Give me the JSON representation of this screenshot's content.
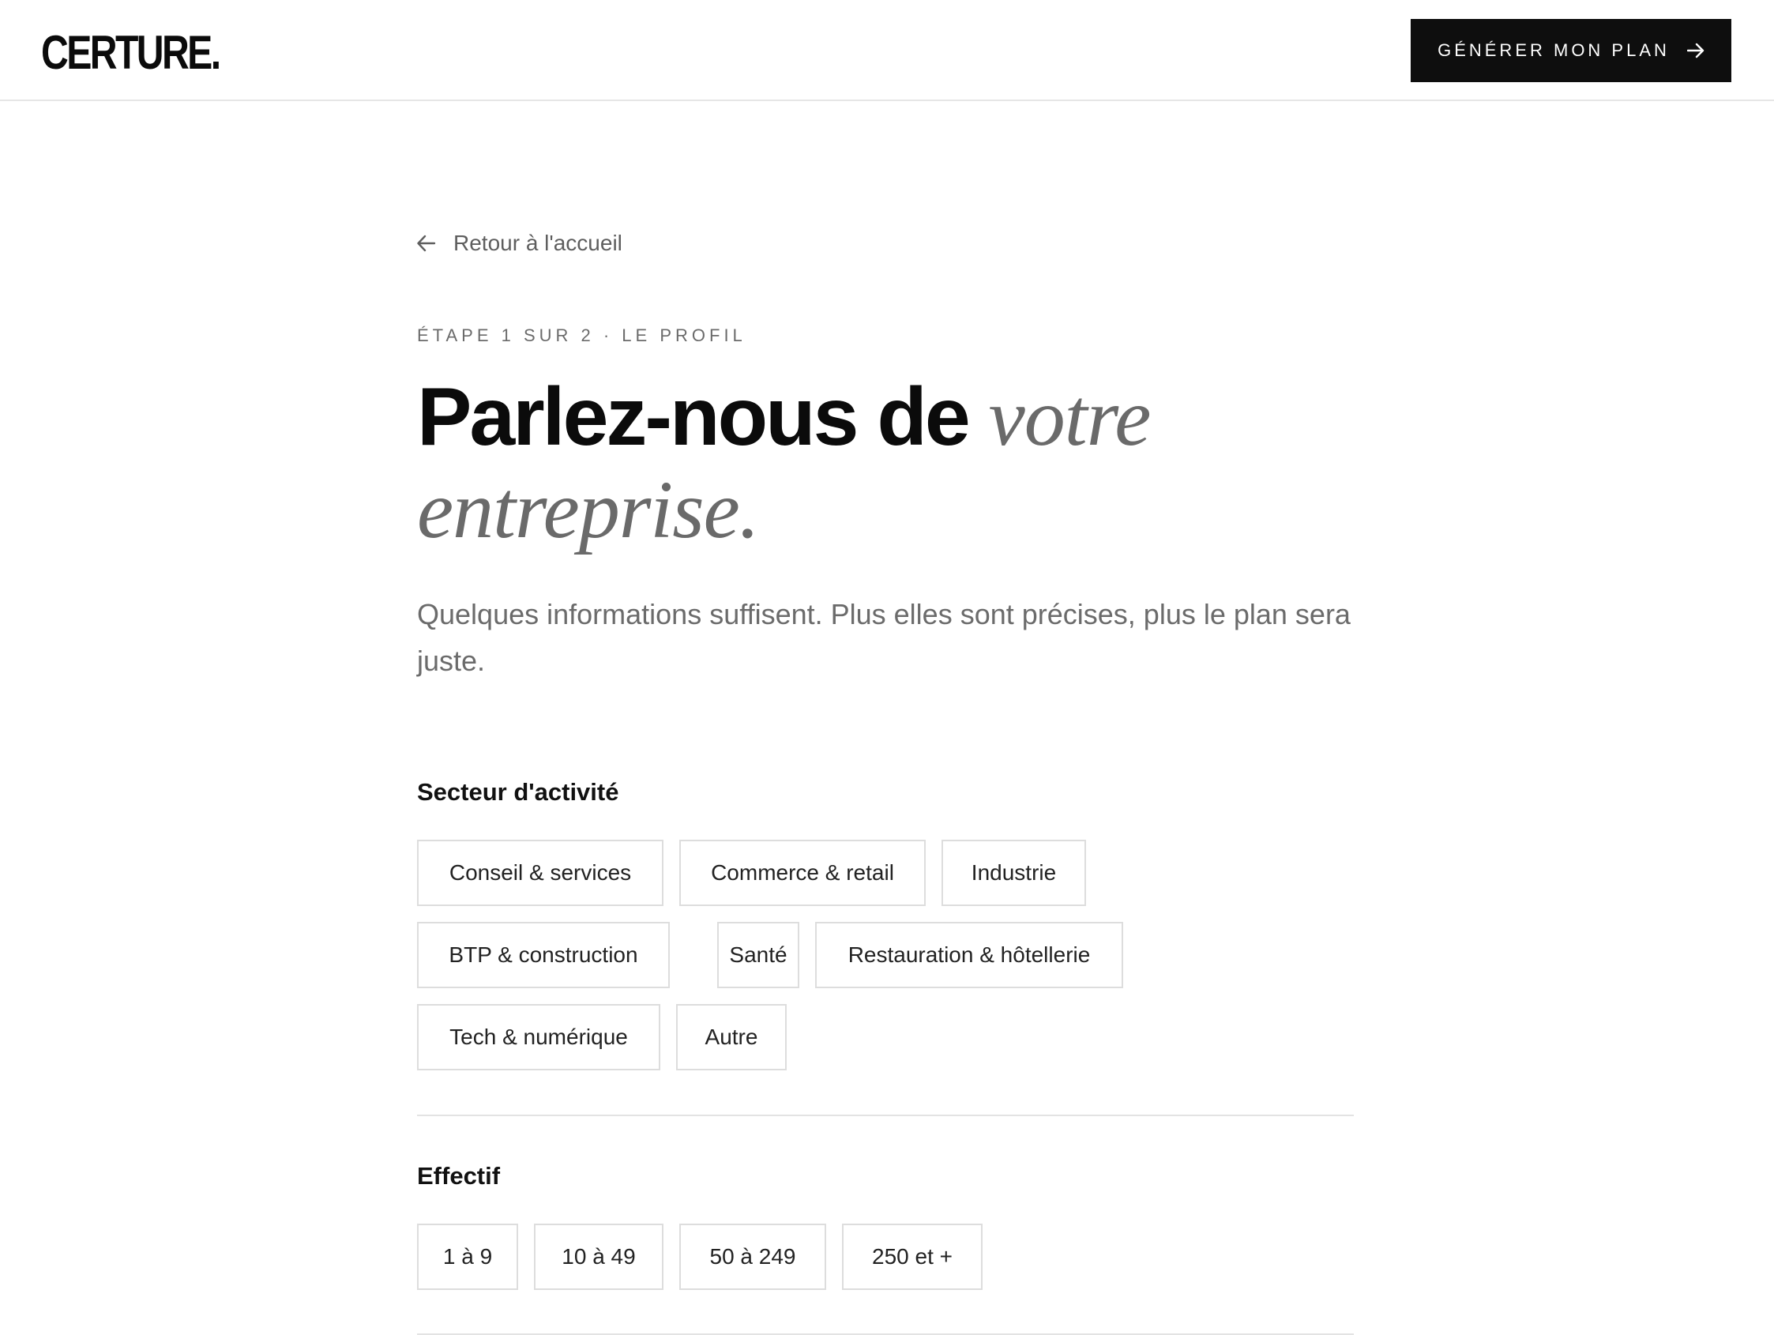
{
  "header": {
    "logo": "CERTURE.",
    "cta_label": "GÉNÉRER MON PLAN"
  },
  "page": {
    "back_label": "Retour à l'accueil",
    "step_label": "ÉTAPE 1 SUR 2 · LE PROFIL",
    "title_main": "Parlez-nous de",
    "title_italic": "votre entreprise.",
    "lead": "Quelques informations suffisent. Plus elles sont précises, plus le plan sera juste."
  },
  "sector": {
    "label": "Secteur d'activité",
    "options": [
      "Conseil & services",
      "Commerce & retail",
      "Industrie",
      "BTP & construction",
      "Santé",
      "Restauration & hôtellerie",
      "Tech & numérique",
      "Autre"
    ]
  },
  "headcount": {
    "label": "Effectif",
    "options": [
      "1 à 9",
      "10 à 49",
      "50 à 249",
      "250 et +"
    ]
  },
  "colors": {
    "ink": "#0e0e0e",
    "muted": "#6b6b6b",
    "border": "#dddddd",
    "background": "#ffffff"
  },
  "icons": {
    "cta": "arrow-right-icon",
    "back": "arrow-left-icon"
  }
}
